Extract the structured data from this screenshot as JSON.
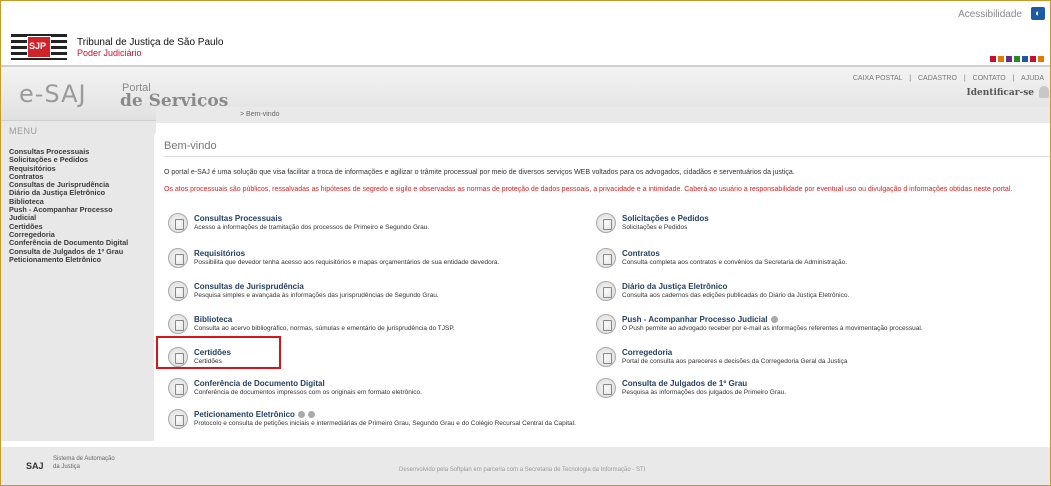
{
  "accessibility": {
    "label": "Acessibilidade"
  },
  "tj": {
    "name": "Tribunal de Justiça de São Paulo",
    "sub": "Poder Judiciário",
    "logo_text": "SJP"
  },
  "portal": {
    "brand": "e-SAJ",
    "portal": "Portal",
    "servicos": "de Serviços"
  },
  "topmenu": {
    "caixa": "CAIXA POSTAL",
    "cadastro": "CADASTRO",
    "contato": "CONTATO",
    "ajuda": "AJUDA",
    "sep": "|"
  },
  "ident": {
    "label": "Identificar-se"
  },
  "breadcrumb": {
    "text": "> Bem-vindo"
  },
  "sidebar": {
    "title": "MENU",
    "items": [
      "Consultas Processuais",
      "Solicitações e Pedidos",
      "Requisitórios",
      "Contratos",
      "Consultas de Jurisprudência",
      "Diário da Justiça Eletrônico",
      "Biblioteca",
      "Push - Acompanhar Processo",
      "Judicial",
      "Certidões",
      "Corregedoria",
      "Conferência de Documento Digital",
      "Consulta de Julgados de 1º Grau",
      "Peticionamento Eletrônico"
    ]
  },
  "main": {
    "title": "Bem-vindo",
    "intro": "O portal e-SAJ é uma solução que visa facilitar a troca de informações e agilizar o trâmite processual por meio de diversos serviços WEB voltados para os advogados, cidadãos e serventuários da justiça.",
    "warning": "Os atos processuais são públicos, ressalvadas as hipóteses de segredo e sigilo e observadas as normas de proteção de dados pessoais, a privacidade e a intimidade. Caberá ao usuário a responsabilidade por eventual uso ou divulgação d informações obtidas neste portal.",
    "services_left": [
      {
        "title": "Consultas Processuais",
        "desc": "Acesso a informações de tramitação dos processos de Primeiro e Segundo Grau."
      },
      {
        "title": "Requisitórios",
        "desc": "Possibilita que devedor tenha acesso aos requisitórios e mapas orçamentários de sua entidade devedora."
      },
      {
        "title": "Consultas de Jurisprudência",
        "desc": "Pesquisa simples e avançada às informações das jurisprudências de Segundo Grau."
      },
      {
        "title": "Biblioteca",
        "desc": "Consulta ao acervo bibliográfico, normas, súmulas e ementário de jurisprudência do TJSP."
      },
      {
        "title": "Certidões",
        "desc": "Certidões"
      },
      {
        "title": "Conferência de Documento Digital",
        "desc": "Conferência de documentos impressos com os originais em formato eletrônico."
      },
      {
        "title": "Peticionamento Eletrônico",
        "desc": "Protocolo e consulta de petições iniciais e intermediárias de Primeiro Grau, Segundo Grau e do Colégio Recursal Central da Capital."
      }
    ],
    "services_right": [
      {
        "title": "Solicitações e Pedidos",
        "desc": "Solicitações e Pedidos"
      },
      {
        "title": "Contratos",
        "desc": "Consulta completa aos contratos e convênios da Secretaria de Administração."
      },
      {
        "title": "Diário da Justiça Eletrônico",
        "desc": "Consulta aos cadernos das edições publicadas do Diário da Justiça Eletrônico."
      },
      {
        "title": "Push - Acompanhar Processo Judicial",
        "desc": "O Push permite ao advogado receber por e-mail as informações referentes à movimentação processual."
      },
      {
        "title": "Corregedoria",
        "desc": "Portal de consulta aos pareceres e decisões da Corregedoria Geral da Justiça"
      },
      {
        "title": "Consulta de Julgados de 1º Grau",
        "desc": "Pesquisa às informações dos julgados de Primeiro Grau."
      }
    ]
  },
  "footer": {
    "saj": "SAJ",
    "saj_text": "Sistema de Automação da Justiça",
    "dev": "Desenvolvido pela Softplan em parceria com a Secretaria de Tecnologia da Informação - STI"
  }
}
